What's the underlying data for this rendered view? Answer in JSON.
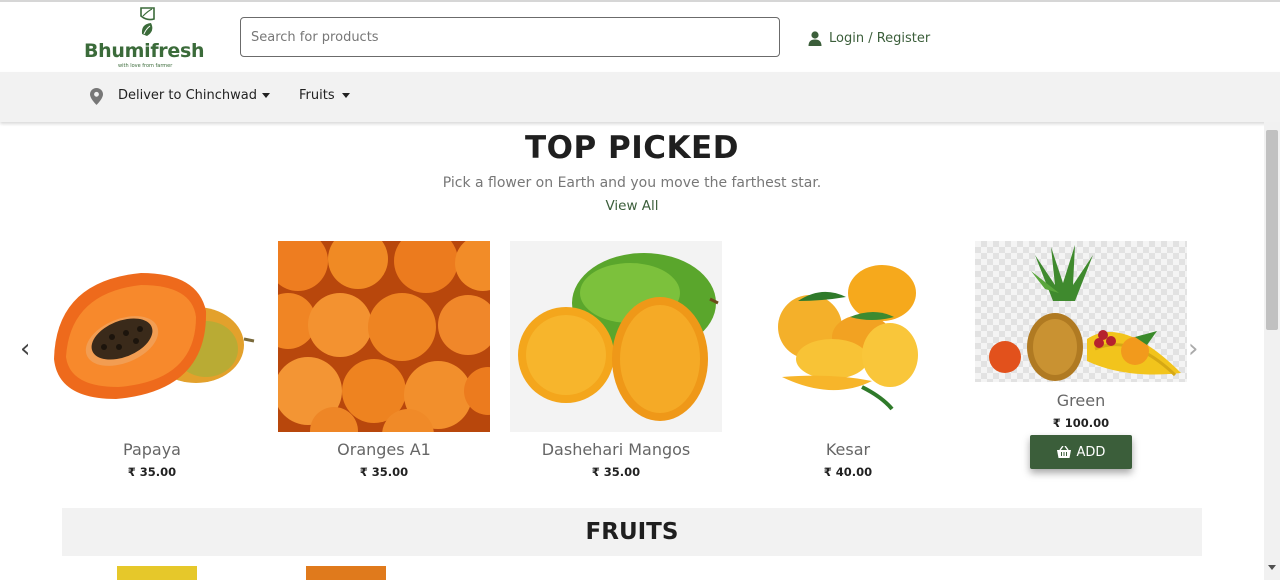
{
  "brand": {
    "name": "Bhumifresh",
    "tagline": "with love from farmer",
    "color": "#3b6b3a"
  },
  "search": {
    "placeholder": "Search for products",
    "value": ""
  },
  "account": {
    "label": "Login / Register",
    "icon": "user-icon"
  },
  "nav": {
    "location_icon": "map-pin-icon",
    "deliver_label": "Deliver to Chinchwad",
    "category_label": "Fruits"
  },
  "top_picked": {
    "title": "TOP PICKED",
    "subtitle": "Pick a flower on Earth and you move the farthest star.",
    "view_all": "View All",
    "prev_icon": "chevron-left-icon",
    "next_icon": "chevron-right-icon",
    "products": [
      {
        "name": "Papaya",
        "price": "₹ 35.00"
      },
      {
        "name": "Oranges A1",
        "price": "₹ 35.00"
      },
      {
        "name": "Dashehari Mangos",
        "price": "₹ 35.00"
      },
      {
        "name": "Kesar",
        "price": "₹ 40.00"
      },
      {
        "name": "Green",
        "price": "₹ 100.00"
      }
    ],
    "add_label": "ADD",
    "add_icon": "basket-icon"
  },
  "fruits_section": {
    "title": "FRUITS"
  },
  "colors": {
    "accent": "#3b5e3a",
    "nav_bg": "#f2f2f2"
  }
}
